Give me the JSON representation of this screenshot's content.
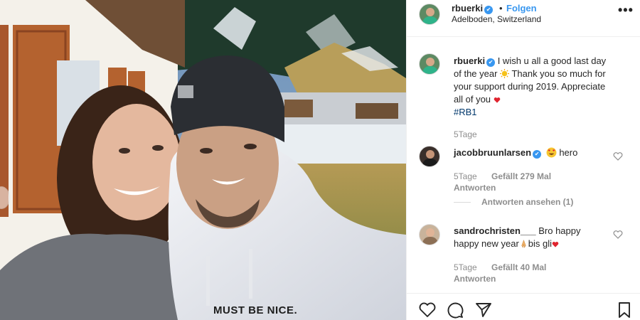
{
  "post": {
    "username": "rbuerki",
    "separator": "•",
    "follow_label": "Folgen",
    "location": "Adelboden, Switzerland",
    "more_icon": "more-icon",
    "caption": {
      "username": "rbuerki",
      "line1": "I wish u all a good last day",
      "line2_a": "of the year",
      "line2_emoji": "sun-emoji",
      "line2_b": " Thank you so much for",
      "line3": "your support during 2019. Appreciate",
      "line4": "all of you",
      "line4_emoji": "heart-emoji",
      "hashtag": "#RB1"
    },
    "caption_age": "5Tage",
    "photo_text": "MUST BE NICE."
  },
  "comments": [
    {
      "username": "jacobbruunlarsen",
      "verified": true,
      "emoji": "heart-eyes-emoji",
      "text": "hero",
      "age": "5Tage",
      "likes": "Gefällt 279 Mal",
      "reply_label": "Antworten",
      "view_replies": "Antworten ansehen (1)"
    },
    {
      "username": "sandrochristen___",
      "line1": "Bro happy",
      "line2_a": "happy new year",
      "line2_emoji": "prayer-emoji",
      "line2_b": "bis gli",
      "line2_emoji2": "heart-emoji",
      "age": "5Tage",
      "likes": "Gefällt 40 Mal",
      "reply_label": "Antworten"
    }
  ],
  "actions": {
    "like": "heart-icon",
    "comment": "comment-icon",
    "share": "share-icon",
    "save": "bookmark-icon"
  },
  "colors": {
    "link_blue": "#3897f0",
    "hashtag": "#00376b",
    "meta_grey": "#8e8e8e",
    "border": "#efefef"
  }
}
